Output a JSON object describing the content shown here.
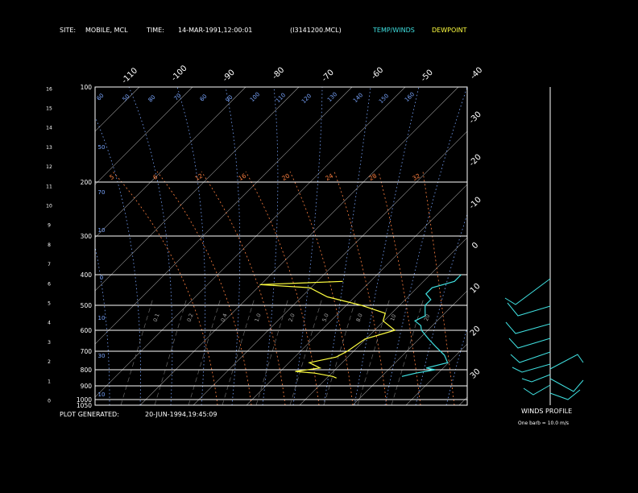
{
  "header": {
    "site_label": "SITE:",
    "site": "MOBILE, MCL",
    "time_label": "TIME:",
    "time": "14-MAR-1991,12:00:01",
    "file": "(I3141200.MCL)",
    "temp_winds_label": "TEMP/WINDS",
    "dewpoint_label": "DEWPOINT"
  },
  "footer": {
    "generated_label": "PLOT GENERATED:",
    "generated": "20-JUN-1994,19:45:09",
    "winds_profile_label": "WINDS PROFILE",
    "barb_note": "One barb = 10.0 m/s"
  },
  "colors": {
    "background": "#000000",
    "frame": "#ffffff",
    "temperature": "#3fe0e0",
    "dewpoint": "#ffff40",
    "dry_adiabat": "#7aa6ff",
    "moist_adiabat": "#ff8040",
    "mixing_ratio": "#6a6a6a"
  },
  "chart_data": {
    "type": "line",
    "pressure_levels": [
      "100",
      "200",
      "300",
      "400",
      "500",
      "600",
      "700",
      "800",
      "900",
      "1000",
      "1050"
    ],
    "pressure_values": [
      100,
      200,
      300,
      400,
      500,
      600,
      700,
      800,
      900,
      1000,
      1050
    ],
    "height_km_ticks": [
      "0",
      "1",
      "2",
      "3",
      "4",
      "5",
      "6",
      "7",
      "8",
      "9",
      "10",
      "11",
      "12",
      "13",
      "14",
      "15",
      "16"
    ],
    "top_temp_labels": [
      "-110",
      "-100",
      "-90",
      "-80",
      "-70",
      "-60",
      "-50",
      "-40"
    ],
    "right_temp_labels": [
      "-30",
      "-20",
      "-10",
      "0",
      "10",
      "20",
      "30"
    ],
    "dry_adiabat_labels_top": [
      "60",
      "50",
      "80",
      "70",
      "60",
      "90",
      "100",
      "110",
      "120",
      "130",
      "140",
      "150",
      "160"
    ],
    "dry_adiabat_labels_left": [
      "50",
      "70",
      "10",
      "0",
      "10",
      "30",
      "10",
      "30",
      "10"
    ],
    "moist_adiabat_labels": [
      "5",
      "6",
      "12",
      "16",
      "20",
      "24",
      "28",
      "32"
    ],
    "mixing_ratio_labels": [
      "0.1",
      "0.2",
      "0.4",
      "1.0",
      "2.0",
      "5.0",
      "8.0",
      "10",
      "20"
    ],
    "temperature_profile": [
      {
        "p": 400,
        "t": -66
      },
      {
        "p": 420,
        "t": -66
      },
      {
        "p": 440,
        "t": -69
      },
      {
        "p": 460,
        "t": -69
      },
      {
        "p": 480,
        "t": -67
      },
      {
        "p": 500,
        "t": -67
      },
      {
        "p": 520,
        "t": -66
      },
      {
        "p": 540,
        "t": -65
      },
      {
        "p": 560,
        "t": -66
      },
      {
        "p": 580,
        "t": -64
      },
      {
        "p": 600,
        "t": -63
      },
      {
        "p": 640,
        "t": -60
      },
      {
        "p": 680,
        "t": -57
      },
      {
        "p": 720,
        "t": -54
      },
      {
        "p": 760,
        "t": -52
      },
      {
        "p": 790,
        "t": -55
      },
      {
        "p": 800,
        "t": -53
      },
      {
        "p": 820,
        "t": -56
      },
      {
        "p": 840,
        "t": -58
      }
    ],
    "dewpoint_profile": [
      {
        "p": 420,
        "t": -87
      },
      {
        "p": 430,
        "t": -102
      },
      {
        "p": 440,
        "t": -92
      },
      {
        "p": 470,
        "t": -87
      },
      {
        "p": 500,
        "t": -79
      },
      {
        "p": 530,
        "t": -73
      },
      {
        "p": 560,
        "t": -72
      },
      {
        "p": 600,
        "t": -68
      },
      {
        "p": 640,
        "t": -72
      },
      {
        "p": 700,
        "t": -73
      },
      {
        "p": 730,
        "t": -74
      },
      {
        "p": 760,
        "t": -78
      },
      {
        "p": 790,
        "t": -75
      },
      {
        "p": 810,
        "t": -79
      },
      {
        "p": 820,
        "t": -75
      },
      {
        "p": 840,
        "t": -71
      },
      {
        "p": 850,
        "t": -70
      }
    ],
    "x_range_skewed_temp_c": [
      -110,
      -40
    ],
    "y_range_pressure_hpa": [
      100,
      1050
    ],
    "y_scale": "log",
    "grid": true
  }
}
